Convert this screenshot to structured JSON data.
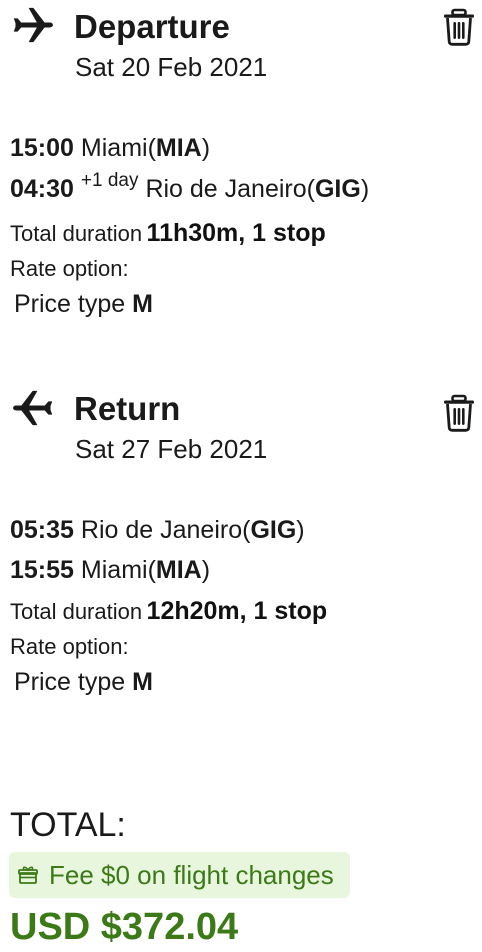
{
  "colors": {
    "text": "#1a1a1a",
    "accent_green": "#3c7a17",
    "fee_badge_bg": "#e7f6dd"
  },
  "departure": {
    "icon": "plane-departure-icon",
    "title": "Departure",
    "date": "Sat 20 Feb 2021",
    "delete_icon": "trash-icon",
    "depart_time": "15:00",
    "depart_city": "Miami",
    "depart_code": "MIA",
    "arrive_time": "04:30",
    "arrive_day_offset": "+1 day",
    "arrive_city": "Rio de Janeiro",
    "arrive_code": "GIG",
    "duration_label": "Total duration",
    "duration_value": "11h30m, 1 stop",
    "rate_label": "Rate option:",
    "price_type_label": "Price type",
    "price_type_value": "M"
  },
  "return": {
    "icon": "plane-return-icon",
    "title": "Return",
    "date": "Sat 27 Feb 2021",
    "delete_icon": "trash-icon",
    "depart_time": "05:35",
    "depart_city": "Rio de Janeiro",
    "depart_code": "GIG",
    "arrive_time": "15:55",
    "arrive_city": "Miami",
    "arrive_code": "MIA",
    "duration_label": "Total duration",
    "duration_value": "12h20m, 1 stop",
    "rate_label": "Rate option:",
    "price_type_label": "Price type",
    "price_type_value": "M"
  },
  "summary": {
    "total_label": "TOTAL:",
    "fee_icon": "gift-icon",
    "fee_text": "Fee $0 on flight changes",
    "total_price": "USD $372.04"
  }
}
